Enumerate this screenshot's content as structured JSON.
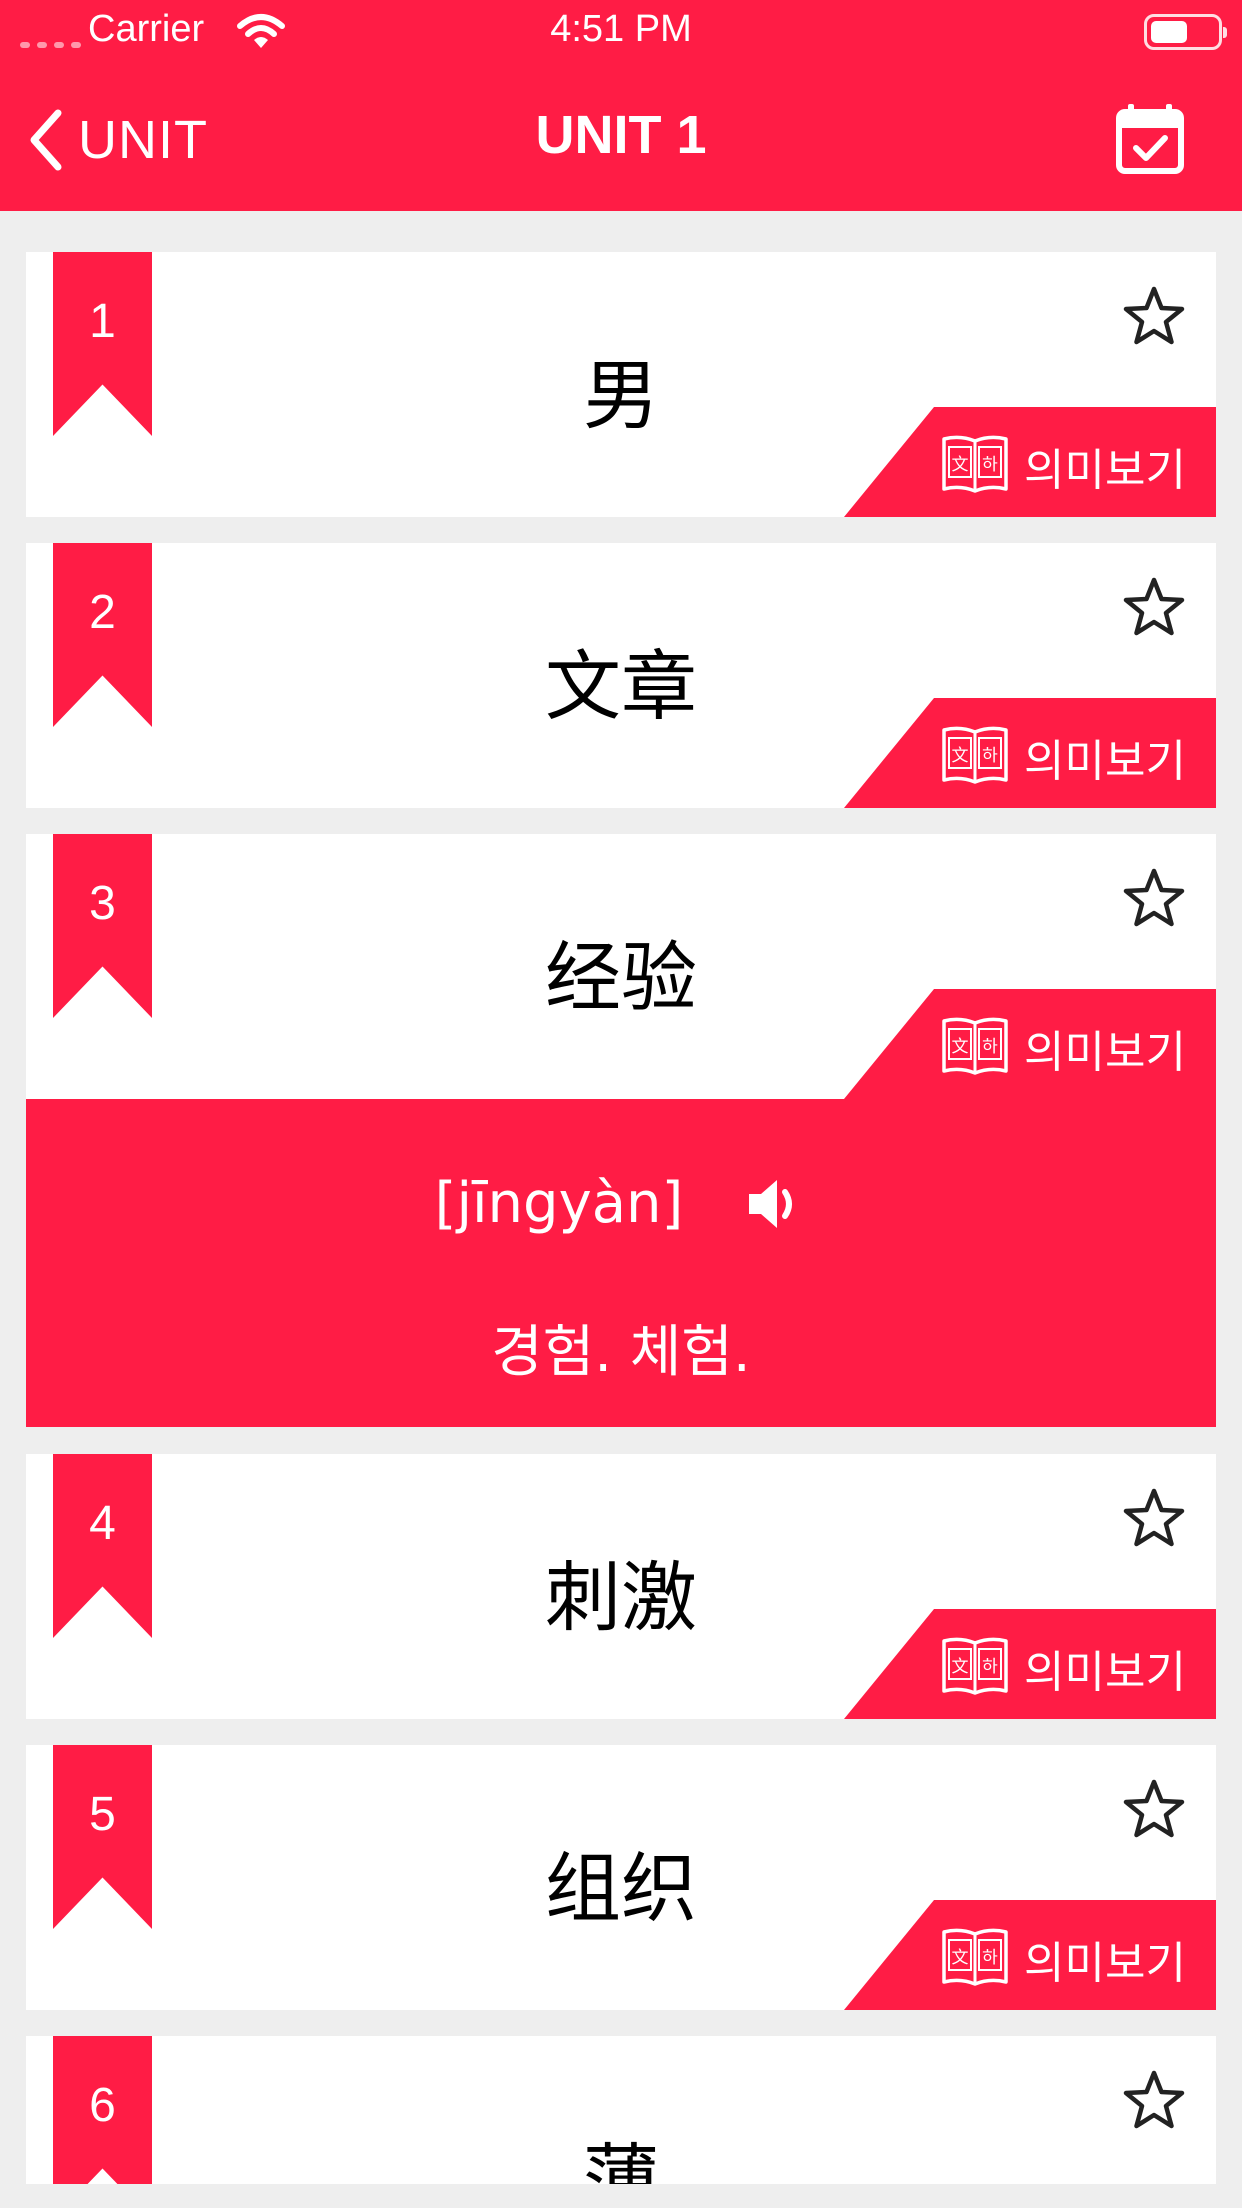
{
  "status_bar": {
    "carrier": "Carrier",
    "time": "4:51 PM"
  },
  "nav": {
    "back_label": "UNIT",
    "title": "UNIT 1"
  },
  "meaning_button_label": "의미보기",
  "dict_icon_text": [
    "文",
    "하"
  ],
  "words": [
    {
      "number": "1",
      "word": "男",
      "starred": false
    },
    {
      "number": "2",
      "word": "文章",
      "starred": false
    },
    {
      "number": "3",
      "word": "经验",
      "starred": false,
      "expanded": true,
      "pinyin": "[jīngyàn]",
      "meaning": "경험. 체험."
    },
    {
      "number": "4",
      "word": "刺激",
      "starred": false
    },
    {
      "number": "5",
      "word": "组织",
      "starred": false
    },
    {
      "number": "6",
      "word": "薄",
      "starred": false
    }
  ],
  "colors": {
    "accent": "#ff1c45",
    "background": "#eeeeee",
    "card": "#ffffff"
  }
}
